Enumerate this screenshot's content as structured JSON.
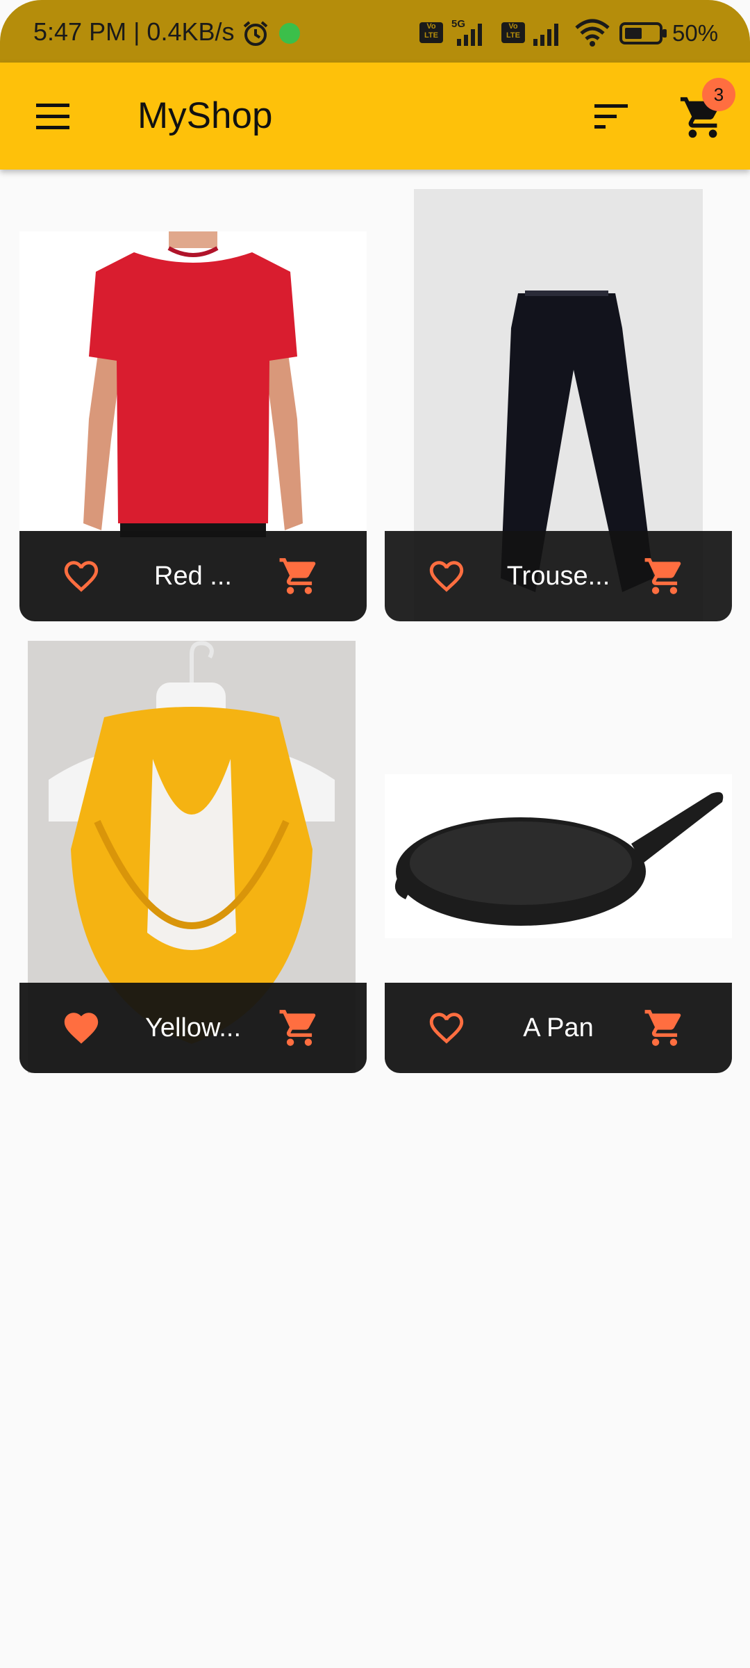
{
  "status_bar": {
    "time_speed": "5:47 PM | 0.4KB/s",
    "network": "5G",
    "volte_label": "Vo LTE",
    "battery": "50%"
  },
  "app_bar": {
    "title": "MyShop",
    "cart_count": "3",
    "menu_icon": "hamburger-menu-icon",
    "sort_icon": "sort-icon",
    "cart_icon": "shopping-cart-icon"
  },
  "products": [
    {
      "title": "Red ...",
      "favorite": false,
      "image": "red-tshirt"
    },
    {
      "title": "Trouse...",
      "favorite": false,
      "image": "black-trousers"
    },
    {
      "title": "Yellow...",
      "favorite": true,
      "image": "yellow-scarf"
    },
    {
      "title": "A Pan",
      "favorite": false,
      "image": "cast-iron-pan"
    }
  ],
  "colors": {
    "status_bar": "#b58d0b",
    "app_bar": "#fec10a",
    "accent": "#ff6e40",
    "tile_footer": "#121212",
    "background": "#fafafa"
  }
}
